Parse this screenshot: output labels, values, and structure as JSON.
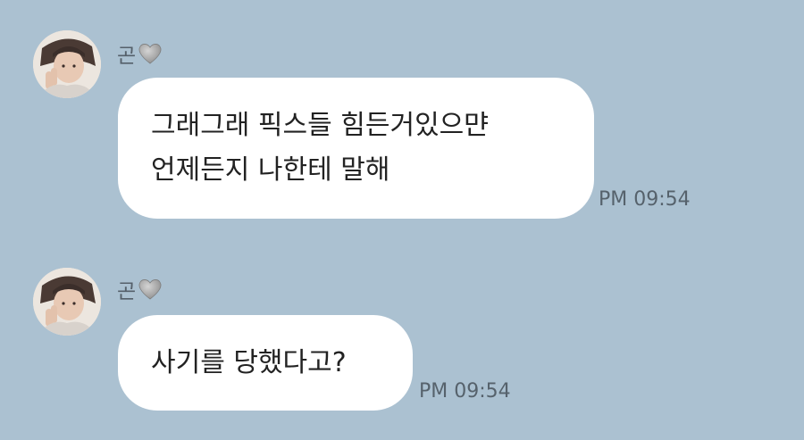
{
  "chat": {
    "messages": [
      {
        "sender_name": "곤",
        "sender_heart_icon": "grey-heart-icon",
        "avatar_icon": "profile-photo",
        "text_lines": [
          "그래그래 픽스들 힘든거있으먄",
          "언제든지 나한테 말해"
        ],
        "time": "PM 09:54"
      },
      {
        "sender_name": "곤",
        "sender_heart_icon": "grey-heart-icon",
        "avatar_icon": "profile-photo",
        "text_lines": [
          "사기를 당했다고?"
        ],
        "time": "PM 09:54"
      }
    ]
  },
  "colors": {
    "background": "#abc1d1",
    "bubble": "#ffffff",
    "heart": "#9a9a9a",
    "time_text": "#56626c"
  }
}
